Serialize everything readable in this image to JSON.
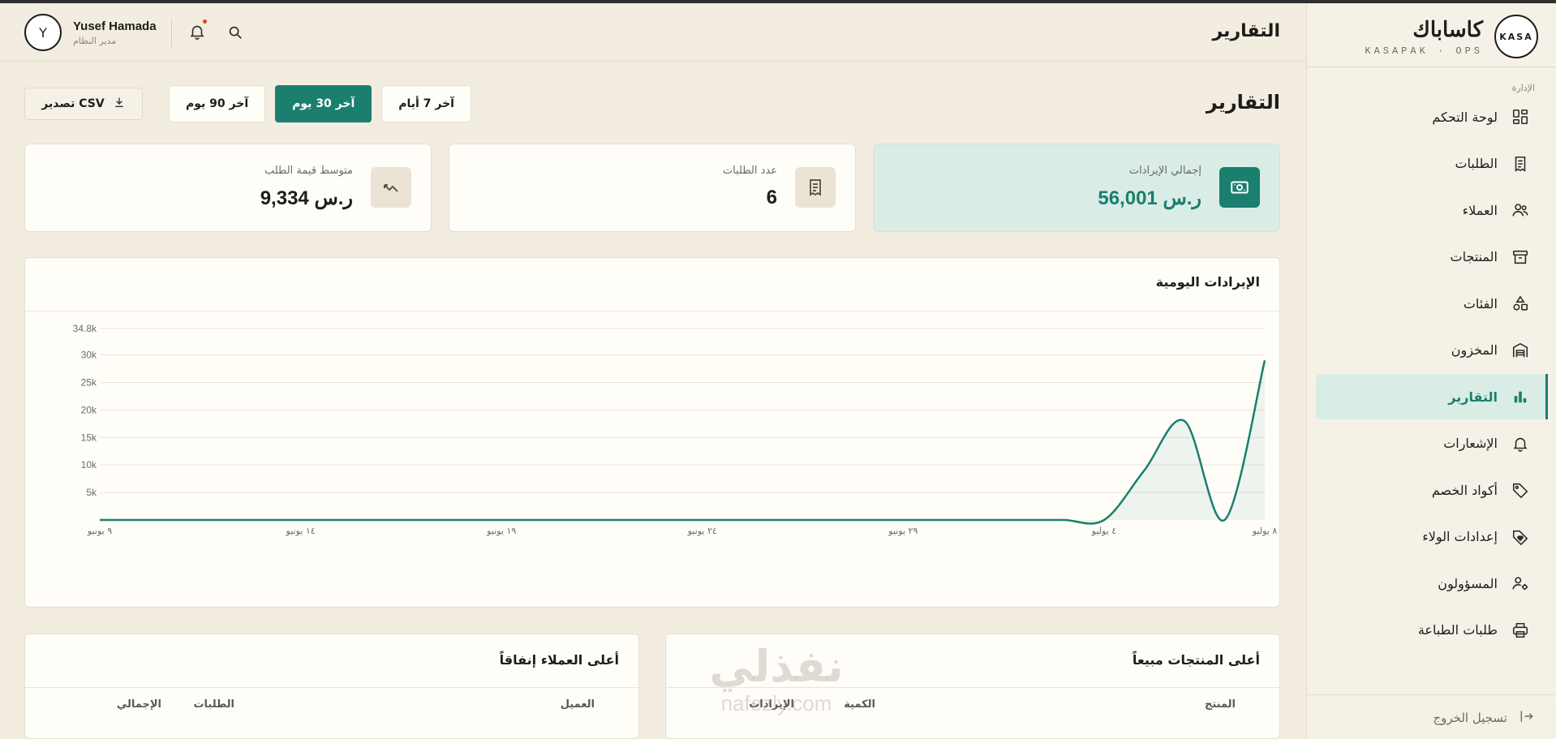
{
  "brand": {
    "logo_text": "KASA",
    "name": "كاساباك",
    "tagline": "KASAPAK · OPS"
  },
  "sidebar": {
    "section_label": "الإدارة",
    "items": [
      {
        "label": "لوحة التحكم",
        "icon": "dashboard-icon"
      },
      {
        "label": "الطلبات",
        "icon": "receipt-icon"
      },
      {
        "label": "العملاء",
        "icon": "users-icon"
      },
      {
        "label": "المنتجات",
        "icon": "box-icon"
      },
      {
        "label": "الفئات",
        "icon": "shapes-icon"
      },
      {
        "label": "المخزون",
        "icon": "warehouse-icon"
      },
      {
        "label": "التقارير",
        "icon": "bar-chart-icon",
        "active": true
      },
      {
        "label": "الإشعارات",
        "icon": "bell-icon"
      },
      {
        "label": "أكواد الخصم",
        "icon": "tag-icon"
      },
      {
        "label": "إعدادات الولاء",
        "icon": "loyalty-tag-icon"
      },
      {
        "label": "المسؤولون",
        "icon": "user-gear-icon"
      },
      {
        "label": "طلبات الطباعة",
        "icon": "printer-icon"
      }
    ],
    "logout_label": "تسجيل الخروج"
  },
  "header": {
    "title": "التقارير",
    "user": {
      "initial": "Y",
      "name": "Yusef Hamada",
      "role": "مدير النظام"
    }
  },
  "main": {
    "page_title": "التقارير",
    "range_tabs": [
      {
        "label": "آخر 7 أيام",
        "active": false
      },
      {
        "label": "آخر 30 يوم",
        "active": true
      },
      {
        "label": "آخر 90 يوم",
        "active": false
      }
    ],
    "export_label": "تصدير CSV",
    "kpis": [
      {
        "label": "إجمالي الإيرادات",
        "value": "56,001 ر.س",
        "icon": "cash-icon"
      },
      {
        "label": "عدد الطلبات",
        "value": "6",
        "icon": "receipt-icon"
      },
      {
        "label": "متوسط قيمة الطلب",
        "value": "9,334 ر.س",
        "icon": "trend-icon"
      }
    ],
    "chart_title": "الإيرادات اليومية",
    "top_products": {
      "title": "أعلى المنتجات مبيعاً",
      "columns": [
        "المنتج",
        "الكمية",
        "الإيرادات"
      ]
    },
    "top_customers": {
      "title": "أعلى العملاء إنفاقاً",
      "columns": [
        "العميل",
        "الطلبات",
        "الإجمالي"
      ]
    }
  },
  "colors": {
    "accent": "#1a7f6e",
    "background": "#f3ede1",
    "card": "#fffdf8",
    "highlight": "#d9ece6"
  },
  "watermark": {
    "arabic": "نفذلي",
    "latin": "nafezly.com"
  },
  "chart_data": {
    "type": "area",
    "title": "الإيرادات اليومية",
    "xlabel": "",
    "ylabel": "",
    "y_ticks": [
      "5k",
      "10k",
      "15k",
      "20k",
      "25k",
      "30k",
      "34.8k"
    ],
    "y_tick_values": [
      5000,
      10000,
      15000,
      20000,
      25000,
      30000,
      34800
    ],
    "ylim": [
      0,
      34800
    ],
    "x_tick_labels": [
      "٩ يونيو",
      "١٤ يونيو",
      "١٩ يونيو",
      "٢٤ يونيو",
      "٢٩ يونيو",
      "٤ يوليو",
      "٨ يوليو"
    ],
    "x_tick_index": [
      0,
      5,
      10,
      15,
      20,
      25,
      29
    ],
    "x_direction": "right-to-left",
    "grid": true,
    "series": [
      {
        "values": [
          0,
          0,
          0,
          0,
          0,
          0,
          0,
          0,
          0,
          0,
          0,
          0,
          0,
          0,
          0,
          0,
          0,
          0,
          0,
          0,
          0,
          0,
          0,
          0,
          0,
          0,
          9000,
          18000,
          0,
          29000
        ]
      }
    ]
  }
}
